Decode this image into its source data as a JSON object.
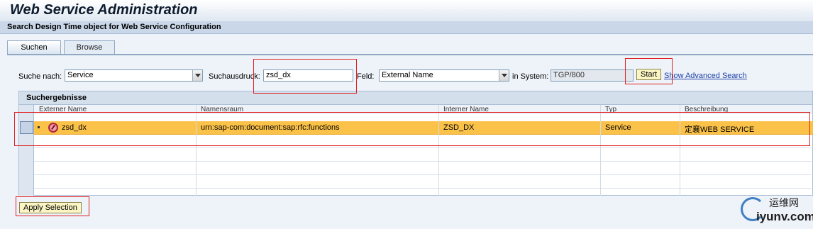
{
  "window": {
    "title": "Web Service Administration",
    "subtitle": "Search Design Time object for Web Service Configuration"
  },
  "tabs": [
    {
      "label": "Suchen",
      "active": true
    },
    {
      "label": "Browse",
      "active": false
    }
  ],
  "search": {
    "search_for_label": "Suche nach:",
    "search_for_value": "Service",
    "expression_label": "Suchausdruck:",
    "expression_value": "zsd_dx",
    "field_label": "Feld:",
    "field_value": "External Name",
    "system_label": "in System:",
    "system_value": "TGP/800",
    "start_label": "Start",
    "advanced_link": "Show Advanced Search"
  },
  "results": {
    "title": "Suchergebnisse",
    "columns": [
      "Externer Name",
      "Namensraum",
      "Interner Name",
      "Typ",
      "Beschreibung"
    ],
    "rows": [
      {
        "external_name": "zsd_dx",
        "namespace": "urn:sap-com:document:sap:rfc:functions",
        "internal_name": "ZSD_DX",
        "type": "Service",
        "description": "定襄WEB SERVICE",
        "selected": true
      }
    ]
  },
  "footer": {
    "apply_label": "Apply Selection"
  },
  "watermark": {
    "top": "运维网",
    "bottom": "iyunv.com"
  },
  "colors": {
    "selected_row": "#fbc24a",
    "highlight_box": "#e02020",
    "link": "#1c3ea8"
  }
}
